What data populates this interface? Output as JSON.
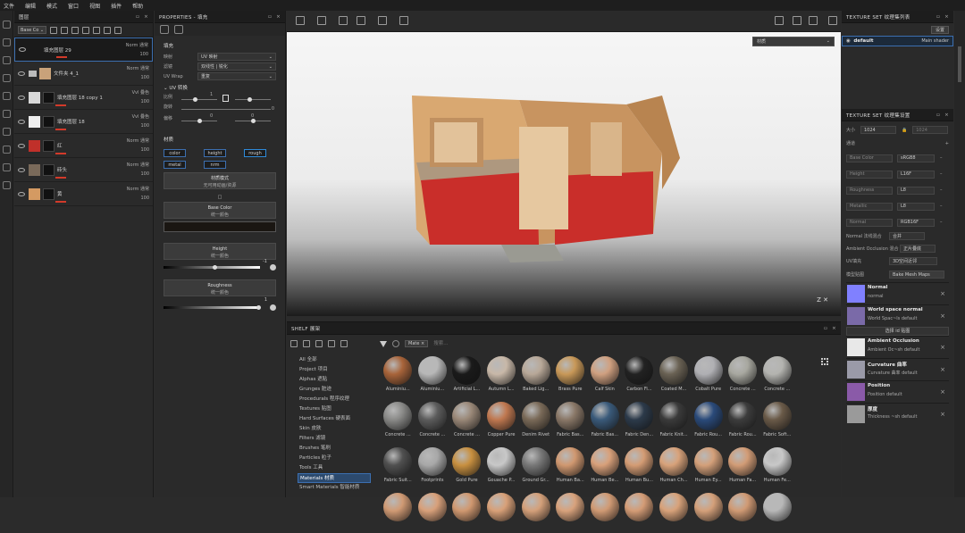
{
  "menu": [
    "文件",
    "编辑",
    "模式",
    "窗口",
    "视图",
    "插件",
    "帮助"
  ],
  "layers": {
    "title": "图层",
    "blend_mode": "Base Co",
    "rows": [
      {
        "name": "填充图层 29",
        "meta1": "Norm 通常",
        "meta2": "100",
        "thumb": "#1a1a1a",
        "selected": true
      },
      {
        "name": "文件夹 4_1",
        "meta1": "Norm 通常",
        "meta2": "100",
        "thumb": "#c9a27a",
        "selected": false
      },
      {
        "name": "填充图层 18 copy 1",
        "meta1": "Vvl 叠色",
        "meta2": "100",
        "thumb": "#d8d8d8",
        "selected": false
      },
      {
        "name": "填充图层 18",
        "meta1": "Vvl 叠色",
        "meta2": "100",
        "thumb": "#eeeeee",
        "selected": false
      },
      {
        "name": "红",
        "meta1": "Norm 通常",
        "meta2": "100",
        "thumb": "#c0302a",
        "selected": false
      },
      {
        "name": "砖头",
        "meta1": "Norm 通常",
        "meta2": "100",
        "thumb": "#7a6a5a",
        "selected": false
      },
      {
        "name": "黄",
        "meta1": "Norm 通常",
        "meta2": "100",
        "thumb": "#d49a62",
        "selected": false
      }
    ]
  },
  "props": {
    "title": "PROPERTIES - 填充",
    "fill_header": "填充",
    "fields": [
      {
        "label": "映射",
        "value": "UV 映射"
      },
      {
        "label": "滤镜",
        "value": "双线性 | 锐化"
      },
      {
        "label": "UV Wrap",
        "value": "重复"
      }
    ],
    "uv_header": "UV 转换",
    "sliders": [
      {
        "label": "比例",
        "value": "1",
        "pos": 0.33
      },
      {
        "label": "旋转",
        "value": "0",
        "pos": 0.0
      },
      {
        "label": "偏移",
        "value": "0",
        "pos": 0.5
      }
    ],
    "material_header": "材质",
    "channels": [
      "color",
      "height",
      "rough",
      "metal",
      "nrm"
    ],
    "material_mode": "材质模式",
    "material_mode_sub": "无可用动画/资源",
    "ellipsis": "□",
    "base_color": "Base Color",
    "base_color_sub": "统一颜色",
    "height": "Height",
    "height_sub": "统一颜色",
    "height_val": "-1",
    "roughness": "Roughness",
    "roughness_sub": "统一颜色",
    "rough_val": "1"
  },
  "viewport": {
    "material_dropdown": "材质"
  },
  "shelf": {
    "title": "SHELF 展架",
    "filter_chip": "Mate ×",
    "search_placeholder": "搜索...",
    "categories": [
      "All 全部",
      "Project 项目",
      "Alphas 遮贴",
      "Grunges 脏迹",
      "Procedurals 程序纹理",
      "Textures 贴图",
      "Hard Surfaces 硬表面",
      "Skin 皮肤",
      "Filters 滤镜",
      "Brushes 笔刷",
      "Particles 粒子",
      "Tools 工具",
      "Materials 材质",
      "Smart Materials 智能材质"
    ],
    "active_category": "Materials 材质",
    "materials": [
      {
        "name": "Aluminiu...",
        "color": "#a8643a"
      },
      {
        "name": "Aluminiu...",
        "color": "#b8b8b8"
      },
      {
        "name": "Artificial L...",
        "color": "#1a1a1a"
      },
      {
        "name": "Autumn L...",
        "color": "#c8b8a8"
      },
      {
        "name": "Baked Lig...",
        "color": "#b8a898"
      },
      {
        "name": "Brass Pure",
        "color": "#c89858"
      },
      {
        "name": "Calf Skin",
        "color": "#d0a080"
      },
      {
        "name": "Carbon Fi...",
        "color": "#222222"
      },
      {
        "name": "Coated M...",
        "color": "#6a6254"
      },
      {
        "name": "Cobalt Pure",
        "color": "#b0b0b4"
      },
      {
        "name": "Concrete ...",
        "color": "#a8a8a0"
      },
      {
        "name": "Concrete ...",
        "color": "#b4b4b0"
      },
      {
        "name": "Concrete ...",
        "color": "#8a8a88"
      },
      {
        "name": "Concrete ...",
        "color": "#5c5c5c"
      },
      {
        "name": "Concrete ...",
        "color": "#9a8878"
      },
      {
        "name": "Copper Pure",
        "color": "#c07850"
      },
      {
        "name": "Denim Rivet",
        "color": "#7a6a58"
      },
      {
        "name": "Fabric Bas...",
        "color": "#8a7868"
      },
      {
        "name": "Fabric Bas...",
        "color": "#3a5a7a"
      },
      {
        "name": "Fabric Den...",
        "color": "#2c3a4a"
      },
      {
        "name": "Fabric Knit...",
        "color": "#3a3a3a"
      },
      {
        "name": "Fabric Rou...",
        "color": "#2a4a7a"
      },
      {
        "name": "Fabric Rou...",
        "color": "#3c3c3c"
      },
      {
        "name": "Fabric Soft...",
        "color": "#6a5a48"
      },
      {
        "name": "Fabric Suit...",
        "color": "#505050"
      },
      {
        "name": "Footprints",
        "color": "#a8a8a8"
      },
      {
        "name": "Gold Pure",
        "color": "#c89040"
      },
      {
        "name": "Gouache P...",
        "color": "#c8c8c8"
      },
      {
        "name": "Ground Gr...",
        "color": "#787878"
      },
      {
        "name": "Human Ba...",
        "color": "#d09870"
      },
      {
        "name": "Human Be...",
        "color": "#d8a07a"
      },
      {
        "name": "Human Bu...",
        "color": "#d49c74"
      },
      {
        "name": "Human Ch...",
        "color": "#d8a27a"
      },
      {
        "name": "Human Ey...",
        "color": "#d4a07a"
      },
      {
        "name": "Human Fa...",
        "color": "#d29c76"
      },
      {
        "name": "Human Fe...",
        "color": "#c8c8c8"
      },
      {
        "name": "",
        "color": "#d09a74"
      },
      {
        "name": "",
        "color": "#d8a07a"
      },
      {
        "name": "",
        "color": "#d09870"
      },
      {
        "name": "",
        "color": "#d8a078"
      },
      {
        "name": "",
        "color": "#d4a07a"
      },
      {
        "name": "",
        "color": "#d8a27c"
      },
      {
        "name": "",
        "color": "#d09a74"
      },
      {
        "name": "",
        "color": "#d49c76"
      },
      {
        "name": "",
        "color": "#d8a27a"
      },
      {
        "name": "",
        "color": "#d4a07a"
      },
      {
        "name": "",
        "color": "#d09a74"
      },
      {
        "name": "",
        "color": "#b8b8b8"
      }
    ]
  },
  "texset_list": {
    "title": "TEXTURE SET 纹理集列表",
    "settings": "设置",
    "item": "default",
    "shader": "Main shader"
  },
  "texset_settings": {
    "title": "TEXTURE SET 纹理集设置",
    "size_label": "大小",
    "size_value": "1024",
    "size_value2": "1024",
    "channels_label": "通道",
    "channels": [
      {
        "name": "Base Color",
        "fmt": "sRGB8"
      },
      {
        "name": "Height",
        "fmt": "L16F"
      },
      {
        "name": "Roughness",
        "fmt": "L8"
      },
      {
        "name": "Metallic",
        "fmt": "L8"
      },
      {
        "name": "Normal",
        "fmt": "RGB16F"
      }
    ],
    "normal_mix_label": "Normal 法线混合",
    "normal_mix": "合并",
    "ao_mix_label": "Ambient Occlusion 混合",
    "ao_mix": "正片叠底",
    "uv_label": "UV填充",
    "uv_value": "3D空间近邻",
    "model_maps_label": "模型贴图",
    "bake_button": "Bake Mesh Maps",
    "select_id": "选择 id 贴图",
    "bakes": [
      {
        "name": "Normal",
        "sub": "normal",
        "color": "#8080ff"
      },
      {
        "name": "World space normal",
        "sub": "World Spac~ls default",
        "color": "#7a6aa8"
      },
      {
        "name": "Ambient Occlusion",
        "sub": "Ambient Oc~sh default",
        "color": "#e8e8e8"
      },
      {
        "name": "Curvature 曲率",
        "sub": "Curvature 曲率 default",
        "color": "#9a9aa8"
      },
      {
        "name": "Position",
        "sub": "Position default",
        "color": "#8a5aa8"
      },
      {
        "name": "厚度",
        "sub": "Thickness ~sh default",
        "color": "#9a9a9a"
      }
    ]
  }
}
